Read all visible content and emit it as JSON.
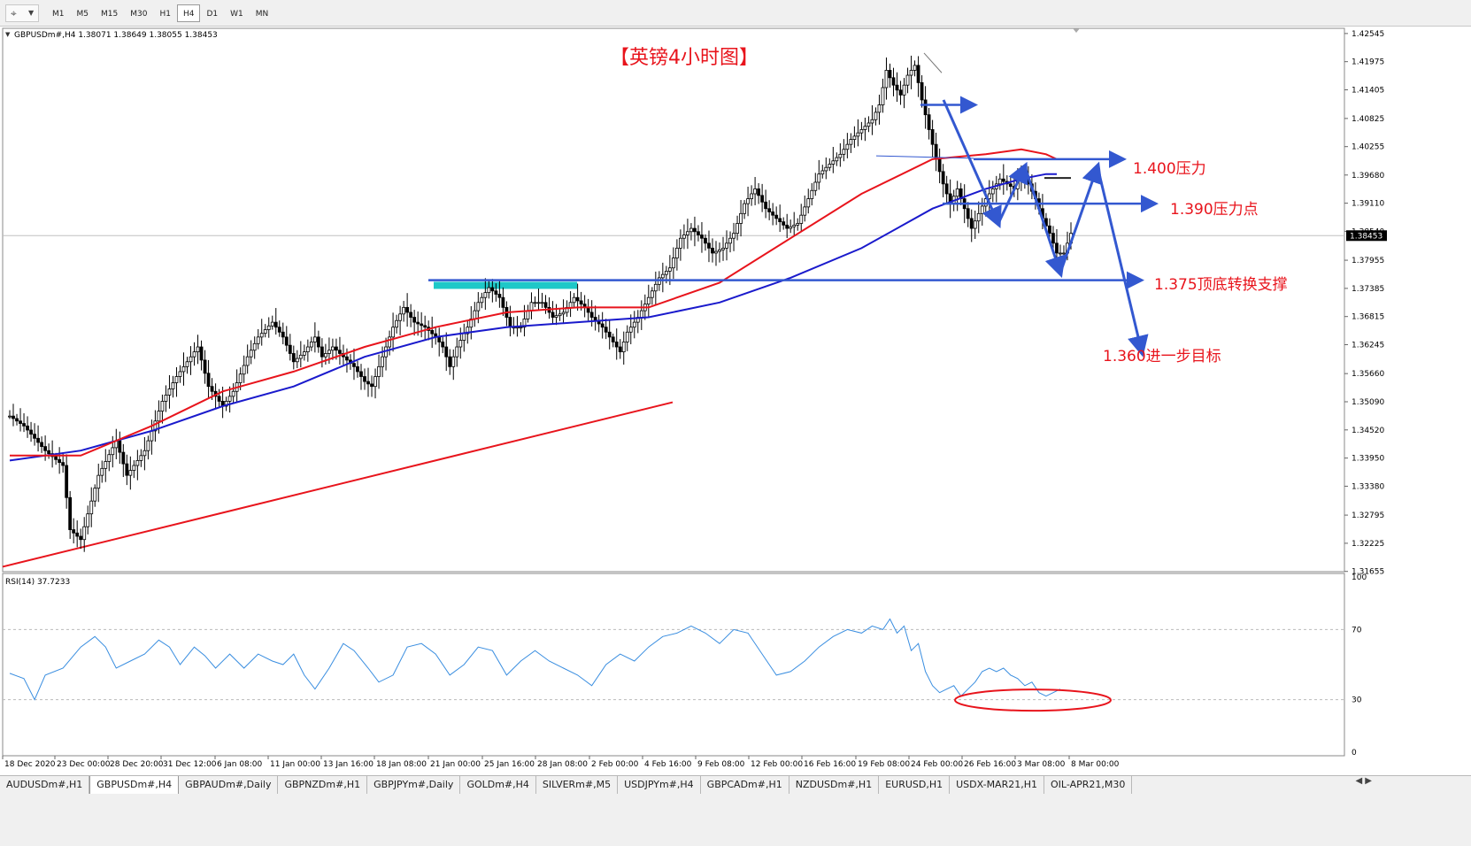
{
  "toolbar": {
    "tool_icon": "cursor-crosshair-icon",
    "timeframes": [
      "M1",
      "M5",
      "M15",
      "M30",
      "H1",
      "H4",
      "D1",
      "W1",
      "MN"
    ],
    "active_timeframe": "H4"
  },
  "header": {
    "info": "GBPUSDm#,H4  1.38071 1.38649 1.38055 1.38453"
  },
  "annotations": {
    "title": "【英镑4小时图】",
    "r1400": "1.400压力",
    "r1390": "1.390压力点",
    "s1375": "1.375顶底转换支撑",
    "t1360": "1.360进一步目标"
  },
  "price_axis": {
    "labels": [
      "1.42545",
      "1.41975",
      "1.41405",
      "1.40825",
      "1.40255",
      "1.39680",
      "1.39110",
      "1.38540",
      "1.37955",
      "1.37385",
      "1.36815",
      "1.36245",
      "1.35660",
      "1.35090",
      "1.34520",
      "1.33950",
      "1.33380",
      "1.32795",
      "1.32225",
      "1.31655"
    ],
    "current_price": "1.38453"
  },
  "time_axis": {
    "labels": [
      "18 Dec 2020",
      "23 Dec 00:00",
      "28 Dec 20:00",
      "31 Dec 12:00",
      "6 Jan 08:00",
      "11 Jan 00:00",
      "13 Jan 16:00",
      "18 Jan 08:00",
      "21 Jan 00:00",
      "25 Jan 16:00",
      "28 Jan 08:00",
      "2 Feb 00:00",
      "4 Feb 16:00",
      "9 Feb 08:00",
      "12 Feb 00:00",
      "16 Feb 16:00",
      "19 Feb 08:00",
      "24 Feb 00:00",
      "26 Feb 16:00",
      "3 Mar 08:00",
      "8 Mar 00:00"
    ]
  },
  "rsi": {
    "label": "RSI(14) 37.7233",
    "levels": [
      "100",
      "70",
      "30",
      "0"
    ]
  },
  "tabs": [
    "AUDUSDm#,H1",
    "GBPUSDm#,H4",
    "GBPAUDm#,Daily",
    "GBPNZDm#,H1",
    "GBPJPYm#,Daily",
    "GOLDm#,H4",
    "SILVERm#,M5",
    "USDJPYm#,H4",
    "GBPCADm#,H1",
    "NZDUSDm#,H1",
    "EURUSD,H1",
    "USDX-MAR21,H1",
    "OIL-APR21,M30"
  ],
  "active_tab": "GBPUSDm#,H4",
  "tab_nav": "◀ ▶",
  "colors": {
    "ma_fast": "#e8141c",
    "ma_slow": "#1a1acc",
    "annotation_text": "#e8141c",
    "arrows": "#3358d0",
    "trendline": "#e8141c",
    "resistance_box": "#1ec8c8",
    "rsi_line": "#3a8ee0",
    "rsi_circle": "#e8141c"
  },
  "chart_data": {
    "type": "candlestick",
    "symbol": "GBPUSDm#",
    "timeframe": "H4",
    "ohlc_current": {
      "open": 1.38071,
      "high": 1.38649,
      "low": 1.38055,
      "close": 1.38453
    },
    "ylim": [
      1.3165,
      1.4265
    ],
    "key_levels": [
      {
        "price": 1.4,
        "label": "1.400压力"
      },
      {
        "price": 1.39,
        "label": "1.390压力点"
      },
      {
        "price": 1.375,
        "label": "1.375顶底转换支撑"
      },
      {
        "price": 1.36,
        "label": "1.360进一步目标"
      }
    ],
    "close_path": [
      [
        0,
        1.348
      ],
      [
        4,
        1.346
      ],
      [
        10,
        1.341
      ],
      [
        15,
        1.338
      ],
      [
        17,
        1.325
      ],
      [
        20,
        1.323
      ],
      [
        25,
        1.336
      ],
      [
        30,
        1.343
      ],
      [
        33,
        1.336
      ],
      [
        38,
        1.341
      ],
      [
        43,
        1.351
      ],
      [
        47,
        1.356
      ],
      [
        50,
        1.359
      ],
      [
        53,
        1.362
      ],
      [
        56,
        1.354
      ],
      [
        60,
        1.35
      ],
      [
        63,
        1.353
      ],
      [
        67,
        1.36
      ],
      [
        70,
        1.364
      ],
      [
        74,
        1.367
      ],
      [
        77,
        1.364
      ],
      [
        80,
        1.359
      ],
      [
        83,
        1.361
      ],
      [
        86,
        1.364
      ],
      [
        88,
        1.36
      ],
      [
        91,
        1.362
      ],
      [
        94,
        1.36
      ],
      [
        97,
        1.358
      ],
      [
        100,
        1.355
      ],
      [
        102,
        1.354
      ],
      [
        105,
        1.36
      ],
      [
        108,
        1.366
      ],
      [
        111,
        1.37
      ],
      [
        114,
        1.367
      ],
      [
        117,
        1.366
      ],
      [
        120,
        1.364
      ],
      [
        122,
        1.362
      ],
      [
        124,
        1.358
      ],
      [
        126,
        1.362
      ],
      [
        129,
        1.366
      ],
      [
        132,
        1.371
      ],
      [
        135,
        1.374
      ],
      [
        138,
        1.372
      ],
      [
        141,
        1.366
      ],
      [
        144,
        1.366
      ],
      [
        147,
        1.371
      ],
      [
        150,
        1.371
      ],
      [
        153,
        1.368
      ],
      [
        156,
        1.369
      ],
      [
        159,
        1.372
      ],
      [
        162,
        1.37
      ],
      [
        164,
        1.368
      ],
      [
        167,
        1.366
      ],
      [
        170,
        1.363
      ],
      [
        172,
        1.361
      ],
      [
        174,
        1.365
      ],
      [
        177,
        1.368
      ],
      [
        180,
        1.372
      ],
      [
        183,
        1.376
      ],
      [
        186,
        1.378
      ],
      [
        189,
        1.384
      ],
      [
        192,
        1.386
      ],
      [
        195,
        1.384
      ],
      [
        198,
        1.381
      ],
      [
        201,
        1.382
      ],
      [
        204,
        1.385
      ],
      [
        207,
        1.391
      ],
      [
        210,
        1.394
      ],
      [
        213,
        1.39
      ],
      [
        216,
        1.388
      ],
      [
        219,
        1.386
      ],
      [
        222,
        1.387
      ],
      [
        225,
        1.392
      ],
      [
        228,
        1.397
      ],
      [
        231,
        1.399
      ],
      [
        234,
        1.401
      ],
      [
        237,
        1.404
      ],
      [
        240,
        1.406
      ],
      [
        243,
        1.408
      ],
      [
        245,
        1.411
      ],
      [
        247,
        1.418
      ],
      [
        249,
        1.415
      ],
      [
        251,
        1.413
      ],
      [
        253,
        1.417
      ],
      [
        255,
        1.419
      ],
      [
        257,
        1.412
      ],
      [
        259,
        1.406
      ],
      [
        261,
        1.4
      ],
      [
        263,
        1.395
      ],
      [
        265,
        1.391
      ],
      [
        267,
        1.394
      ],
      [
        269,
        1.39
      ],
      [
        271,
        1.386
      ],
      [
        273,
        1.389
      ],
      [
        275,
        1.392
      ],
      [
        277,
        1.394
      ],
      [
        279,
        1.396
      ],
      [
        281,
        1.395
      ],
      [
        283,
        1.394
      ],
      [
        285,
        1.397
      ],
      [
        287,
        1.395
      ],
      [
        289,
        1.392
      ],
      [
        291,
        1.388
      ],
      [
        293,
        1.385
      ],
      [
        295,
        1.381
      ],
      [
        297,
        1.381
      ],
      [
        299,
        1.385
      ]
    ],
    "ma_fast_path": [
      [
        0,
        1.34
      ],
      [
        20,
        1.34
      ],
      [
        40,
        1.346
      ],
      [
        60,
        1.353
      ],
      [
        80,
        1.357
      ],
      [
        100,
        1.362
      ],
      [
        120,
        1.366
      ],
      [
        140,
        1.369
      ],
      [
        160,
        1.37
      ],
      [
        180,
        1.37
      ],
      [
        200,
        1.375
      ],
      [
        220,
        1.384
      ],
      [
        240,
        1.393
      ],
      [
        260,
        1.4
      ],
      [
        275,
        1.401
      ],
      [
        285,
        1.402
      ],
      [
        292,
        1.401
      ],
      [
        295,
        1.4
      ]
    ],
    "ma_slow_path": [
      [
        0,
        1.339
      ],
      [
        20,
        1.341
      ],
      [
        40,
        1.345
      ],
      [
        60,
        1.35
      ],
      [
        80,
        1.354
      ],
      [
        100,
        1.36
      ],
      [
        120,
        1.364
      ],
      [
        140,
        1.366
      ],
      [
        160,
        1.367
      ],
      [
        180,
        1.368
      ],
      [
        200,
        1.371
      ],
      [
        220,
        1.376
      ],
      [
        240,
        1.382
      ],
      [
        260,
        1.39
      ],
      [
        275,
        1.394
      ],
      [
        285,
        1.396
      ],
      [
        292,
        1.397
      ],
      [
        295,
        1.397
      ]
    ],
    "rsi_path": [
      [
        0,
        45
      ],
      [
        4,
        42
      ],
      [
        7,
        30
      ],
      [
        10,
        44
      ],
      [
        15,
        48
      ],
      [
        20,
        60
      ],
      [
        24,
        66
      ],
      [
        27,
        60
      ],
      [
        30,
        48
      ],
      [
        34,
        52
      ],
      [
        38,
        56
      ],
      [
        42,
        64
      ],
      [
        45,
        60
      ],
      [
        48,
        50
      ],
      [
        52,
        60
      ],
      [
        55,
        55
      ],
      [
        58,
        48
      ],
      [
        62,
        56
      ],
      [
        66,
        48
      ],
      [
        70,
        56
      ],
      [
        74,
        52
      ],
      [
        77,
        50
      ],
      [
        80,
        56
      ],
      [
        83,
        44
      ],
      [
        86,
        36
      ],
      [
        90,
        48
      ],
      [
        94,
        62
      ],
      [
        97,
        58
      ],
      [
        101,
        48
      ],
      [
        104,
        40
      ],
      [
        108,
        44
      ],
      [
        112,
        60
      ],
      [
        116,
        62
      ],
      [
        120,
        56
      ],
      [
        124,
        44
      ],
      [
        128,
        50
      ],
      [
        132,
        60
      ],
      [
        136,
        58
      ],
      [
        140,
        44
      ],
      [
        144,
        52
      ],
      [
        148,
        58
      ],
      [
        152,
        52
      ],
      [
        156,
        48
      ],
      [
        160,
        44
      ],
      [
        164,
        38
      ],
      [
        168,
        50
      ],
      [
        172,
        56
      ],
      [
        176,
        52
      ],
      [
        180,
        60
      ],
      [
        184,
        66
      ],
      [
        188,
        68
      ],
      [
        192,
        72
      ],
      [
        196,
        68
      ],
      [
        200,
        62
      ],
      [
        204,
        70
      ],
      [
        208,
        68
      ],
      [
        212,
        56
      ],
      [
        216,
        44
      ],
      [
        220,
        46
      ],
      [
        224,
        52
      ],
      [
        228,
        60
      ],
      [
        232,
        66
      ],
      [
        236,
        70
      ],
      [
        240,
        68
      ],
      [
        243,
        72
      ],
      [
        246,
        70
      ],
      [
        248,
        76
      ],
      [
        250,
        68
      ],
      [
        252,
        72
      ],
      [
        254,
        58
      ],
      [
        256,
        62
      ],
      [
        258,
        46
      ],
      [
        260,
        38
      ],
      [
        262,
        34
      ],
      [
        264,
        36
      ],
      [
        266,
        38
      ],
      [
        268,
        32
      ],
      [
        270,
        36
      ],
      [
        272,
        40
      ],
      [
        274,
        46
      ],
      [
        276,
        48
      ],
      [
        278,
        46
      ],
      [
        280,
        48
      ],
      [
        282,
        44
      ],
      [
        284,
        42
      ],
      [
        286,
        38
      ],
      [
        288,
        40
      ],
      [
        290,
        34
      ],
      [
        292,
        32
      ],
      [
        294,
        34
      ],
      [
        296,
        36
      ]
    ],
    "rsi_levels": [
      70,
      30
    ]
  }
}
